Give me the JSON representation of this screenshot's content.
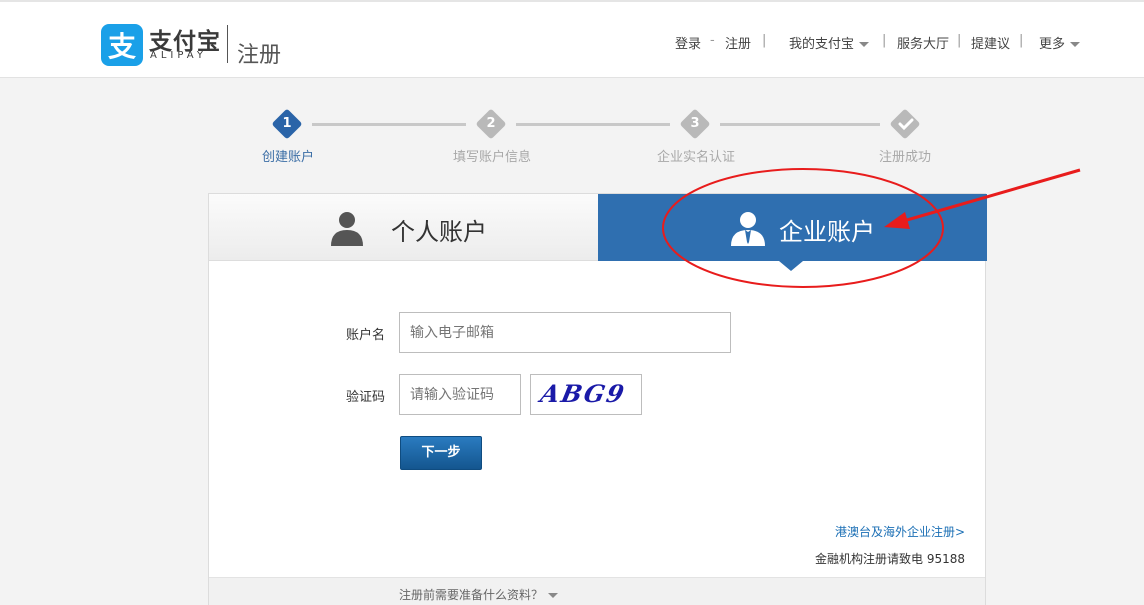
{
  "header": {
    "logo_cn": "支付宝",
    "logo_en": "ALIPAY",
    "page_title": "注册",
    "nav": {
      "login": "登录",
      "register": "注册",
      "my_alipay": "我的支付宝",
      "service_hall": "服务大厅",
      "feedback": "提建议",
      "more": "更多"
    }
  },
  "steps": [
    {
      "num": "1",
      "label": "创建账户",
      "state": "active"
    },
    {
      "num": "2",
      "label": "填写账户信息",
      "state": "pending"
    },
    {
      "num": "3",
      "label": "企业实名认证",
      "state": "pending"
    },
    {
      "num": "",
      "label": "注册成功",
      "state": "pending"
    }
  ],
  "tabs": {
    "personal": "个人账户",
    "enterprise": "企业账户"
  },
  "form": {
    "account_label": "账户名",
    "account_placeholder": "输入电子邮箱",
    "captcha_label": "验证码",
    "captcha_placeholder": "请输入验证码",
    "captcha_image_text": "ABG9",
    "next_button": "下一步"
  },
  "links": {
    "overseas": "港澳台及海外企业注册>",
    "hotline": "金融机构注册请致电 95188",
    "prep": "注册前需要准备什么资料？"
  },
  "colors": {
    "brand_blue": "#1aa0e8",
    "tab_active": "#2f6fb0",
    "step_active": "#2a64a8",
    "step_pending": "#b9b9b9",
    "annotation_red": "#e81c1c"
  }
}
